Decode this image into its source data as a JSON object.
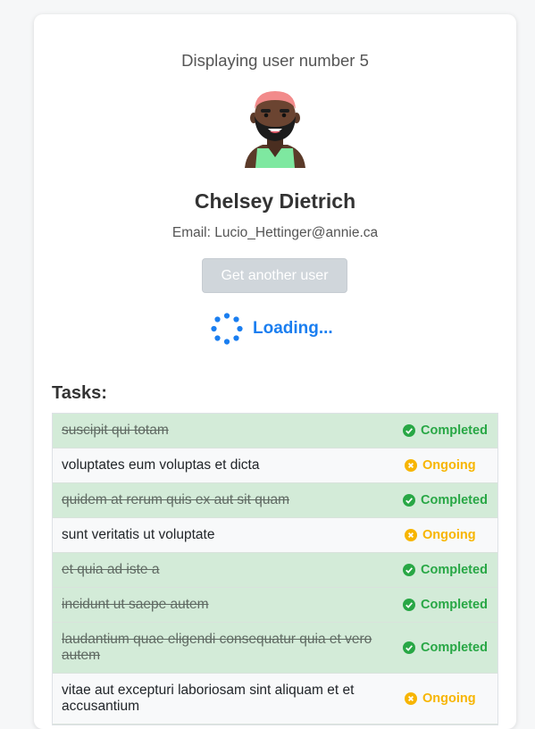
{
  "header": {
    "heading": "Displaying user number 5"
  },
  "user": {
    "name": "Chelsey Dietrich",
    "email": "Email: Lucio_Hettinger@annie.ca"
  },
  "actions": {
    "get_user_label": "Get another user",
    "loading_label": "Loading..."
  },
  "tasks": {
    "title": "Tasks:",
    "items": [
      {
        "title": "suscipit qui totam",
        "status": "Completed",
        "completed": true
      },
      {
        "title": "voluptates eum voluptas et dicta",
        "status": "Ongoing",
        "completed": false
      },
      {
        "title": "quidem at rerum quis ex aut sit quam",
        "status": "Completed",
        "completed": true
      },
      {
        "title": "sunt veritatis ut voluptate",
        "status": "Ongoing",
        "completed": false
      },
      {
        "title": "et quia ad iste a",
        "status": "Completed",
        "completed": true
      },
      {
        "title": "incidunt ut saepe autem",
        "status": "Completed",
        "completed": true
      },
      {
        "title": "laudantium quae eligendi consequatur quia et vero autem",
        "status": "Completed",
        "completed": true
      },
      {
        "title": "vitae aut excepturi laboriosam sint aliquam et et accusantium",
        "status": "Ongoing",
        "completed": false
      }
    ]
  },
  "colors": {
    "completed": "#28a745",
    "ongoing": "#f7b500",
    "accent": "#1a7ef0"
  },
  "icons": {
    "completed": "check-circle-icon",
    "ongoing": "x-circle-icon"
  }
}
